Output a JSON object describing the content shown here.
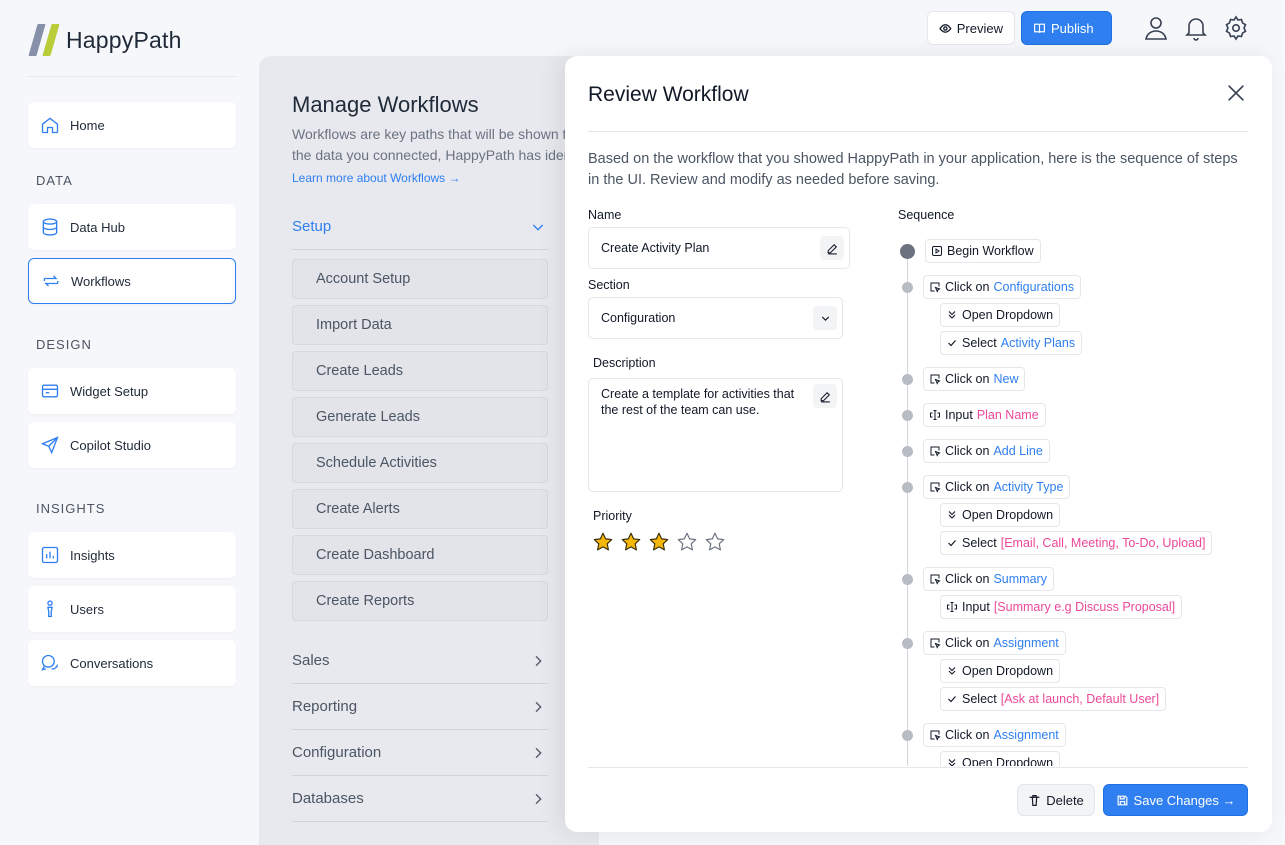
{
  "app": {
    "name": "HappyPath"
  },
  "sidebar": {
    "home": "Home",
    "sections": {
      "data": "DATA",
      "design": "DESIGN",
      "insights": "INSIGHTS"
    },
    "items": {
      "data_hub": "Data Hub",
      "workflows": "Workflows",
      "widget_setup": "Widget Setup",
      "copilot_studio": "Copilot Studio",
      "insights": "Insights",
      "users": "Users",
      "conversations": "Conversations"
    },
    "active": "workflows"
  },
  "topbar": {
    "preview": "Preview",
    "publish": "Publish"
  },
  "main": {
    "title": "Manage Workflows",
    "description": "Workflows are key paths that will be shown to users in your application. Based on the data you connected, HappyPath has identified these workflows.",
    "learn_more": "Learn more about Workflows →",
    "setup": {
      "label": "Setup",
      "items": [
        "Account Setup",
        "Import Data",
        "Create Leads",
        "Generate Leads",
        "Schedule Activities",
        "Create Alerts",
        "Create Dashboard",
        "Create Reports"
      ]
    },
    "groups": [
      "Sales",
      "Reporting",
      "Configuration",
      "Databases"
    ]
  },
  "panel": {
    "title": "Review Workflow",
    "intro": "Based on the workflow that you showed HappyPath in your application, here is the sequence of steps in the UI. Review and modify as needed before saving.",
    "name_label": "Name",
    "name_value": "Create Activity Plan",
    "section_label": "Section",
    "section_value": "Configuration",
    "description_label": "Description",
    "description_value": "Create a template for activities that the rest of the team can use.",
    "priority_label": "Priority",
    "priority_value": 3,
    "priority_max": 5,
    "sequence_label": "Sequence",
    "sequence": {
      "begin": "Begin Workflow",
      "click_on": "Click on",
      "input": "Input",
      "open_dropdown": "Open Dropdown",
      "select": "Select",
      "targets": {
        "configurations": "Configurations",
        "activity_plans": "Activity Plans",
        "new": "New",
        "plan_name": "Plan Name",
        "add_line": "Add Line",
        "activity_type": "Activity Type",
        "activity_options": "[Email, Call, Meeting, To-Do, Upload]",
        "summary": "Summary",
        "summary_hint": "[Summary e.g Discuss Proposal]",
        "assignment": "Assignment",
        "assignment_options": "[Ask at launch, Default User]",
        "assignment2": "Assignment"
      }
    },
    "delete": "Delete",
    "save": "Save Changes →"
  },
  "colors": {
    "accent": "#2f7ff0",
    "highlight_pink": "#ec4899",
    "star": "#f5b70a"
  }
}
